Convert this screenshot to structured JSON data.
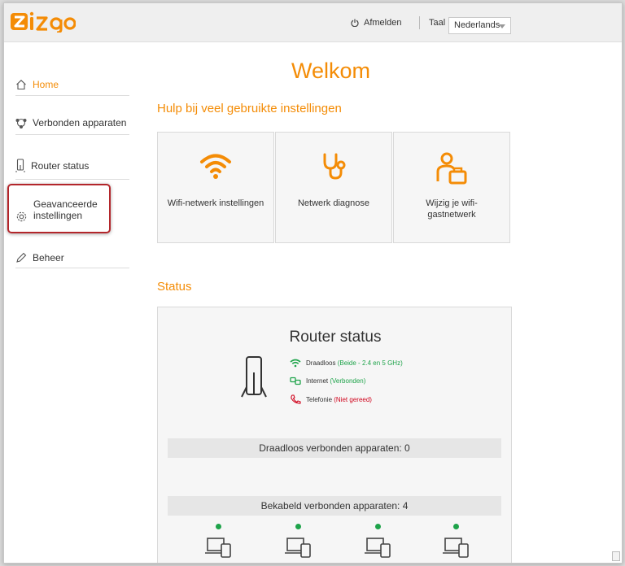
{
  "header": {
    "logo_text": "ziggo",
    "logout_label": "Afmelden",
    "language_label": "Taal",
    "language_value": "Nederlands"
  },
  "sidebar": {
    "items": [
      {
        "label": "Home",
        "icon": "home-icon",
        "active": true
      },
      {
        "label": "Verbonden apparaten",
        "icon": "devices-icon",
        "active": false
      },
      {
        "label": "Router status",
        "icon": "router-icon",
        "active": false
      },
      {
        "label": "Geavanceerde instellingen",
        "icon": "gear-icon",
        "active": false
      },
      {
        "label": "Beheer",
        "icon": "pencil-icon",
        "active": false
      }
    ]
  },
  "main": {
    "title": "Welkom",
    "help_title": "Hulp bij veel gebruikte instellingen",
    "tiles": [
      {
        "label": "Wifi-netwerk instellingen",
        "icon": "wifi-icon"
      },
      {
        "label": "Netwerk diagnose",
        "icon": "stethoscope-icon"
      },
      {
        "label": "Wijzig je wifi-gastnetwerk",
        "icon": "guest-icon"
      }
    ],
    "status_title": "Status",
    "router_status": {
      "title": "Router status",
      "wireless_label": "Draadloos",
      "wireless_value": "(Beide - 2.4 en 5 GHz)",
      "internet_label": "Internet",
      "internet_value": "(Verbonden)",
      "telephony_label": "Telefonie",
      "telephony_value": "(Niet gereed)"
    },
    "wireless_devices": "Draadloos verbonden apparaten: 0",
    "wired_devices": "Bekabeld verbonden apparaten: 4"
  },
  "colors": {
    "accent": "#f48c06",
    "ok": "#1ea34a",
    "error": "#d0021b",
    "highlight": "#b3262b"
  }
}
